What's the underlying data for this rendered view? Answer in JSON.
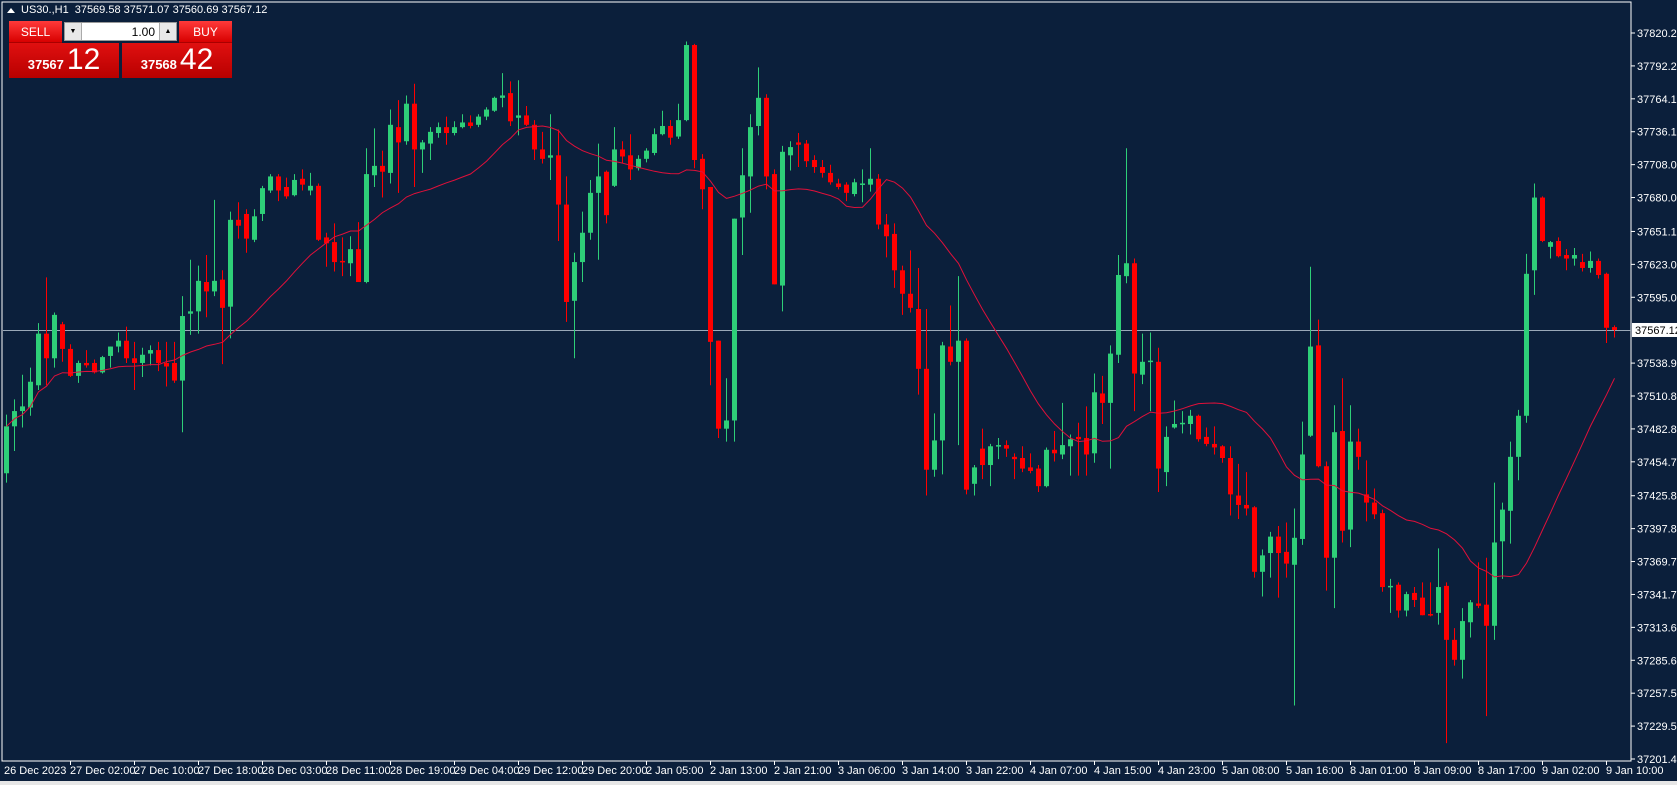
{
  "header": {
    "symbol": "US30.,H1",
    "ohlc": "37569.58 37571.07 37560.69 37567.12"
  },
  "trade_panel": {
    "sell_label": "SELL",
    "buy_label": "BUY",
    "lot_value": "1.00",
    "sell_price_small": "37567",
    "sell_price_big": "12",
    "buy_price_small": "37568",
    "buy_price_big": "42"
  },
  "colors": {
    "background": "#0b1f3b",
    "bull": "#2ecf78",
    "bear": "#ff0000",
    "ma": "#e0103a",
    "axis": "#ffffff",
    "price_line": "#9aa8b8"
  },
  "chart_data": {
    "type": "candlestick",
    "title": "US30.,H1",
    "timeframe": "H1",
    "indicator": {
      "type": "SMA",
      "period": 20
    },
    "current_price": "37567.12",
    "y_ticks": [
      "37820.25",
      "37792.20",
      "37764.15",
      "37736.10",
      "37708.05",
      "37680.00",
      "37651.10",
      "37623.05",
      "37595.00",
      "37538.90",
      "37510.85",
      "37482.80",
      "37454.75",
      "37425.85",
      "37397.80",
      "37369.75",
      "37341.70",
      "37313.65",
      "37285.60",
      "37257.55",
      "37229.50",
      "37201.45"
    ],
    "ylim": [
      37201.45,
      37820.25
    ],
    "x_labels": [
      {
        "bar": 0,
        "text": "26 Dec 2023"
      },
      {
        "bar": 8,
        "text": "27 Dec 02:00"
      },
      {
        "bar": 16,
        "text": "27 Dec 10:00"
      },
      {
        "bar": 24,
        "text": "27 Dec 18:00"
      },
      {
        "bar": 32,
        "text": "28 Dec 03:00"
      },
      {
        "bar": 40,
        "text": "28 Dec 11:00"
      },
      {
        "bar": 48,
        "text": "28 Dec 19:00"
      },
      {
        "bar": 56,
        "text": "29 Dec 04:00"
      },
      {
        "bar": 64,
        "text": "29 Dec 12:00"
      },
      {
        "bar": 72,
        "text": "29 Dec 20:00"
      },
      {
        "bar": 80,
        "text": "2 Jan 05:00"
      },
      {
        "bar": 88,
        "text": "2 Jan 13:00"
      },
      {
        "bar": 96,
        "text": "2 Jan 21:00"
      },
      {
        "bar": 104,
        "text": "3 Jan 06:00"
      },
      {
        "bar": 112,
        "text": "3 Jan 14:00"
      },
      {
        "bar": 120,
        "text": "3 Jan 22:00"
      },
      {
        "bar": 128,
        "text": "4 Jan 07:00"
      },
      {
        "bar": 136,
        "text": "4 Jan 15:00"
      },
      {
        "bar": 144,
        "text": "4 Jan 23:00"
      },
      {
        "bar": 152,
        "text": "5 Jan 08:00"
      },
      {
        "bar": 160,
        "text": "5 Jan 16:00"
      },
      {
        "bar": 168,
        "text": "8 Jan 01:00"
      },
      {
        "bar": 176,
        "text": "8 Jan 09:00"
      },
      {
        "bar": 184,
        "text": "8 Jan 17:00"
      },
      {
        "bar": 192,
        "text": "9 Jan 02:00"
      },
      {
        "bar": 200,
        "text": "9 Jan 10:00"
      }
    ],
    "candles_format": [
      "open",
      "high",
      "low",
      "close"
    ],
    "candles": [
      [
        37445,
        37495,
        37437,
        37485
      ],
      [
        37485,
        37508,
        37464,
        37498
      ],
      [
        37498,
        37529,
        37484,
        37502
      ],
      [
        37501,
        37535,
        37494,
        37523
      ],
      [
        37520,
        37573,
        37516,
        37564
      ],
      [
        37564,
        37612,
        37520,
        37543
      ],
      [
        37543,
        37582,
        37535,
        37580
      ],
      [
        37572,
        37574,
        37540,
        37551
      ],
      [
        37551,
        37555,
        37527,
        37528
      ],
      [
        37528,
        37541,
        37522,
        37539
      ],
      [
        37539,
        37550,
        37535,
        37537
      ],
      [
        37539,
        37542,
        37530,
        37531
      ],
      [
        37531,
        37545,
        37530,
        37544
      ],
      [
        37545,
        37553,
        37535,
        37553
      ],
      [
        37553,
        37565,
        37548,
        37558
      ],
      [
        37558,
        37570,
        37539,
        37543
      ],
      [
        37543,
        37557,
        37516,
        37539
      ],
      [
        37539,
        37552,
        37527,
        37546
      ],
      [
        37547,
        37554,
        37537,
        37550
      ],
      [
        37550,
        37557,
        37532,
        37539
      ],
      [
        37539,
        37557,
        37519,
        37536
      ],
      [
        37539,
        37557,
        37522,
        37524
      ],
      [
        37524,
        37596,
        37480,
        37579
      ],
      [
        37581,
        37627,
        37563,
        37583
      ],
      [
        37583,
        37622,
        37564,
        37609
      ],
      [
        37608,
        37631,
        37578,
        37600
      ],
      [
        37600,
        37678,
        37596,
        37609
      ],
      [
        37610,
        37618,
        37538,
        37586
      ],
      [
        37587,
        37668,
        37560,
        37661
      ],
      [
        37661,
        37676,
        37645,
        37656
      ],
      [
        37666,
        37670,
        37633,
        37645
      ],
      [
        37644,
        37670,
        37642,
        37664
      ],
      [
        37666,
        37690,
        37660,
        37688
      ],
      [
        37686,
        37700,
        37684,
        37698
      ],
      [
        37698,
        37700,
        37677,
        37686
      ],
      [
        37689,
        37697,
        37679,
        37681
      ],
      [
        37682,
        37700,
        37681,
        37695
      ],
      [
        37696,
        37704,
        37686,
        37691
      ],
      [
        37686,
        37701,
        37682,
        37690
      ],
      [
        37690,
        37692,
        37643,
        37644
      ],
      [
        37646,
        37650,
        37621,
        37641
      ],
      [
        37642,
        37658,
        37617,
        37625
      ],
      [
        37626,
        37646,
        37613,
        37625
      ],
      [
        37624,
        37647,
        37613,
        37636
      ],
      [
        37636,
        37659,
        37608,
        37608
      ],
      [
        37608,
        37722,
        37607,
        37700
      ],
      [
        37699,
        37739,
        37689,
        37707
      ],
      [
        37707,
        37720,
        37680,
        37702
      ],
      [
        37701,
        37755,
        37692,
        37742
      ],
      [
        37740,
        37763,
        37684,
        37727
      ],
      [
        37728,
        37767,
        37725,
        37760
      ],
      [
        37760,
        37777,
        37689,
        37721
      ],
      [
        37721,
        37729,
        37701,
        37727
      ],
      [
        37726,
        37740,
        37712,
        37736
      ],
      [
        37735,
        37744,
        37731,
        37740
      ],
      [
        37740,
        37749,
        37725,
        37735
      ],
      [
        37735,
        37745,
        37733,
        37740
      ],
      [
        37740,
        37751,
        37739,
        37744
      ],
      [
        37744,
        37750,
        37739,
        37741
      ],
      [
        37742,
        37751,
        37740,
        37749
      ],
      [
        37749,
        37757,
        37746,
        37755
      ],
      [
        37754,
        37766,
        37753,
        37765
      ],
      [
        37765,
        37786,
        37757,
        37767
      ],
      [
        37769,
        37779,
        37741,
        37745
      ],
      [
        37748,
        37780,
        37733,
        37750
      ],
      [
        37750,
        37758,
        37741,
        37742
      ],
      [
        37742,
        37746,
        37712,
        37721
      ],
      [
        37721,
        37736,
        37709,
        37713
      ],
      [
        37714,
        37751,
        37695,
        37716
      ],
      [
        37716,
        37738,
        37643,
        37674
      ],
      [
        37674,
        37698,
        37574,
        37591
      ],
      [
        37592,
        37633,
        37543,
        37625
      ],
      [
        37625,
        37668,
        37608,
        37650
      ],
      [
        37650,
        37695,
        37644,
        37684
      ],
      [
        37684,
        37726,
        37627,
        37698
      ],
      [
        37702,
        37703,
        37658,
        37665
      ],
      [
        37690,
        37740,
        37689,
        37721
      ],
      [
        37721,
        37728,
        37709,
        37715
      ],
      [
        37716,
        37734,
        37695,
        37704
      ],
      [
        37705,
        37716,
        37703,
        37713
      ],
      [
        37713,
        37722,
        37710,
        37720
      ],
      [
        37718,
        37739,
        37716,
        37734
      ],
      [
        37734,
        37754,
        37733,
        37741
      ],
      [
        37741,
        37746,
        37725,
        37731
      ],
      [
        37732,
        37760,
        37730,
        37746
      ],
      [
        37746,
        37813,
        37745,
        37810
      ],
      [
        37810,
        37811,
        37705,
        37712
      ],
      [
        37713,
        37717,
        37670,
        37687
      ],
      [
        37689,
        37689,
        37520,
        37557
      ],
      [
        37558,
        37558,
        37475,
        37483
      ],
      [
        37483,
        37526,
        37472,
        37490
      ],
      [
        37490,
        37662,
        37472,
        37662
      ],
      [
        37663,
        37722,
        37631,
        37699
      ],
      [
        37698,
        37751,
        37667,
        37740
      ],
      [
        37741,
        37791,
        37733,
        37765
      ],
      [
        37765,
        37768,
        37687,
        37698
      ],
      [
        37700,
        37704,
        37606,
        37606
      ],
      [
        37605,
        37724,
        37583,
        37719
      ],
      [
        37716,
        37728,
        37703,
        37723
      ],
      [
        37727,
        37735,
        37706,
        37725
      ],
      [
        37726,
        37729,
        37706,
        37711
      ],
      [
        37712,
        37716,
        37701,
        37706
      ],
      [
        37706,
        37712,
        37697,
        37701
      ],
      [
        37701,
        37708,
        37691,
        37693
      ],
      [
        37692,
        37696,
        37687,
        37689
      ],
      [
        37691,
        37693,
        37677,
        37684
      ],
      [
        37683,
        37696,
        37681,
        37693
      ],
      [
        37691,
        37704,
        37676,
        37692
      ],
      [
        37691,
        37722,
        37685,
        37696
      ],
      [
        37696,
        37700,
        37653,
        37657
      ],
      [
        37657,
        37666,
        37629,
        37647
      ],
      [
        37649,
        37658,
        37603,
        37618
      ],
      [
        37618,
        37622,
        37580,
        37598
      ],
      [
        37598,
        37635,
        37582,
        37586
      ],
      [
        37585,
        37620,
        37512,
        37534
      ],
      [
        37534,
        37585,
        37426,
        37448
      ],
      [
        37448,
        37496,
        37442,
        37473
      ],
      [
        37473,
        37557,
        37444,
        37554
      ],
      [
        37553,
        37588,
        37537,
        37540
      ],
      [
        37540,
        37613,
        37469,
        37558
      ],
      [
        37558,
        37560,
        37427,
        37431
      ],
      [
        37436,
        37452,
        37426,
        37450
      ],
      [
        37466,
        37483,
        37440,
        37452
      ],
      [
        37452,
        37470,
        37434,
        37468
      ],
      [
        37468,
        37475,
        37457,
        37469
      ],
      [
        37469,
        37473,
        37459,
        37466
      ],
      [
        37459,
        37462,
        37440,
        37457
      ],
      [
        37458,
        37468,
        37446,
        37449
      ],
      [
        37450,
        37462,
        37445,
        37447
      ],
      [
        37449,
        37452,
        37429,
        37434
      ],
      [
        37434,
        37467,
        37433,
        37465
      ],
      [
        37465,
        37481,
        37455,
        37462
      ],
      [
        37461,
        37505,
        37457,
        37469
      ],
      [
        37468,
        37478,
        37443,
        37474
      ],
      [
        37476,
        37488,
        37443,
        37474
      ],
      [
        37475,
        37502,
        37443,
        37461
      ],
      [
        37462,
        37530,
        37454,
        37514
      ],
      [
        37513,
        37528,
        37487,
        37505
      ],
      [
        37505,
        37554,
        37449,
        37547
      ],
      [
        37546,
        37631,
        37539,
        37614
      ],
      [
        37613,
        37722,
        37607,
        37624
      ],
      [
        37624,
        37628,
        37498,
        37530
      ],
      [
        37529,
        37564,
        37521,
        37540
      ],
      [
        37540,
        37565,
        37498,
        37541
      ],
      [
        37540,
        37552,
        37429,
        37449
      ],
      [
        37446,
        37485,
        37434,
        37476
      ],
      [
        37484,
        37507,
        37483,
        37487
      ],
      [
        37487,
        37498,
        37479,
        37488
      ],
      [
        37487,
        37499,
        37478,
        37494
      ],
      [
        37494,
        37495,
        37472,
        37474
      ],
      [
        37476,
        37484,
        37468,
        37470
      ],
      [
        37470,
        37485,
        37461,
        37467
      ],
      [
        37468,
        37469,
        37454,
        37458
      ],
      [
        37458,
        37468,
        37409,
        37427
      ],
      [
        37426,
        37453,
        37406,
        37418
      ],
      [
        37418,
        37446,
        37409,
        37415
      ],
      [
        37416,
        37417,
        37356,
        37361
      ],
      [
        37361,
        37380,
        37340,
        37375
      ],
      [
        37377,
        37395,
        37356,
        37391
      ],
      [
        37391,
        37400,
        37339,
        37377
      ],
      [
        37378,
        37403,
        37356,
        37368
      ],
      [
        37367,
        37415,
        37247,
        37390
      ],
      [
        37389,
        37489,
        37384,
        37461
      ],
      [
        37477,
        37621,
        37476,
        37553
      ],
      [
        37554,
        37576,
        37450,
        37451
      ],
      [
        37451,
        37455,
        37345,
        37373
      ],
      [
        37373,
        37503,
        37330,
        37480
      ],
      [
        37481,
        37526,
        37386,
        37396
      ],
      [
        37397,
        37503,
        37382,
        37472
      ],
      [
        37472,
        37483,
        37448,
        37459
      ],
      [
        37427,
        37456,
        37404,
        37420
      ],
      [
        37420,
        37432,
        37406,
        37410
      ],
      [
        37411,
        37414,
        37344,
        37348
      ],
      [
        37348,
        37355,
        37326,
        37349
      ],
      [
        37350,
        37352,
        37322,
        37328
      ],
      [
        37328,
        37344,
        37323,
        37342
      ],
      [
        37343,
        37348,
        37331,
        37337
      ],
      [
        37339,
        37352,
        37324,
        37324
      ],
      [
        37325,
        37352,
        37323,
        37324
      ],
      [
        37326,
        37381,
        37316,
        37348
      ],
      [
        37349,
        37352,
        37215,
        37303
      ],
      [
        37303,
        37313,
        37281,
        37286
      ],
      [
        37286,
        37330,
        37270,
        37319
      ],
      [
        37318,
        37337,
        37305,
        37335
      ],
      [
        37334,
        37369,
        37330,
        37332
      ],
      [
        37333,
        37373,
        37238,
        37315
      ],
      [
        37315,
        37437,
        37303,
        37386
      ],
      [
        37387,
        37420,
        37355,
        37414
      ],
      [
        37413,
        37472,
        37385,
        37459
      ],
      [
        37459,
        37499,
        37439,
        37494
      ],
      [
        37494,
        37632,
        37488,
        37615
      ],
      [
        37618,
        37692,
        37597,
        37680
      ],
      [
        37680,
        37681,
        37642,
        37643
      ],
      [
        37638,
        37643,
        37628,
        37642
      ],
      [
        37643,
        37646,
        37629,
        37630
      ],
      [
        37631,
        37636,
        37618,
        37628
      ],
      [
        37628,
        37637,
        37622,
        37631
      ],
      [
        37625,
        37632,
        37617,
        37620
      ],
      [
        37620,
        37634,
        37616,
        37626
      ],
      [
        37626,
        37628,
        37611,
        37614
      ],
      [
        37615,
        37616,
        37556,
        37569
      ],
      [
        37569.58,
        37571.07,
        37560.69,
        37567.12
      ]
    ]
  }
}
